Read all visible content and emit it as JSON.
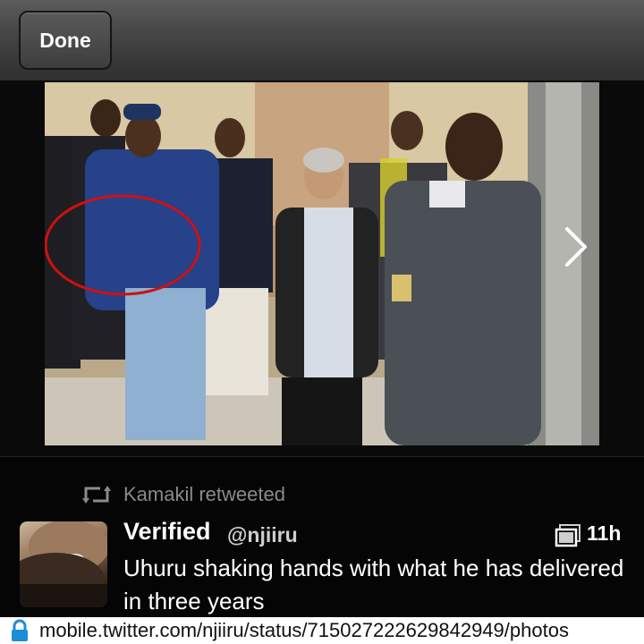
{
  "topbar": {
    "done_label": "Done"
  },
  "tweet": {
    "retweet_label": "Kamakil retweeted",
    "display_name": "Verified",
    "handle": "@njiiru",
    "time": "11h",
    "text": "Uhuru shaking hands with what he has delivered in three years"
  },
  "urlbar": {
    "url": "mobile.twitter.com/njiiru/status/715027222629842949/photos"
  },
  "icons": [
    "next-arrow-icon",
    "retweet-icon",
    "photo-stack-icon",
    "lock-icon"
  ],
  "colors": {
    "background": "#000000",
    "accent_lock": "#1a8fd6",
    "annotation_circle": "#d01010"
  }
}
